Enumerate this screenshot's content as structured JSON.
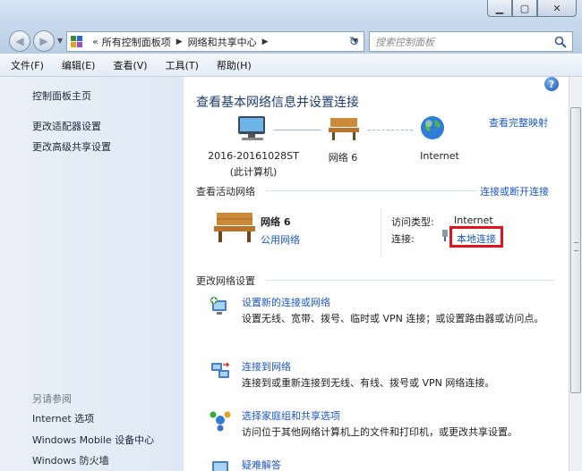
{
  "address": {
    "prefix": "«",
    "crumbs": [
      "所有控制面板项",
      "网络和共享中心"
    ],
    "search_placeholder": "搜索控制面板"
  },
  "menu": [
    "文件(F)",
    "编辑(E)",
    "查看(V)",
    "工具(T)",
    "帮助(H)"
  ],
  "sidebar": {
    "top_links": [
      "控制面板主页",
      "更改适配器设置",
      "更改高级共享设置"
    ],
    "see_also_title": "另请参阅",
    "see_also_links": [
      "Internet 选项",
      "Windows Mobile 设备中心",
      "Windows 防火墙"
    ]
  },
  "main": {
    "title": "查看基本网络信息并设置连接",
    "map_link": "查看完整映射",
    "map_nodes": {
      "computer_name": "2016-20161028ST",
      "computer_sub": "(此计算机)",
      "network": "网络  6",
      "internet": "Internet"
    },
    "active_header": "查看活动网络",
    "connect_link": "连接或断开连接",
    "active": {
      "name": "网络  6",
      "type": "公用网络",
      "access_label": "访问类型:",
      "access_value": "Internet",
      "conn_label": "连接:",
      "conn_value": "本地连接"
    },
    "settings_header": "更改网络设置",
    "tasks": [
      {
        "title": "设置新的连接或网络",
        "desc": "设置无线、宽带、拨号、临时或 VPN 连接；或设置路由器或访问点。"
      },
      {
        "title": "连接到网络",
        "desc": "连接到或重新连接到无线、有线、拨号或 VPN 网络连接。"
      },
      {
        "title": "选择家庭组和共享选项",
        "desc": "访问位于其他网络计算机上的文件和打印机，或更改共享设置。"
      },
      {
        "title": "疑难解答",
        "desc": ""
      }
    ]
  },
  "icons": {
    "help": "?",
    "back": "◀",
    "forward": "▶",
    "refresh": "↻",
    "minimize": "▁",
    "maximize": "▢",
    "close": "✕"
  },
  "colors": {
    "link": "#1c57c4",
    "title": "#1e3c6e",
    "highlight": "#e0141e"
  }
}
